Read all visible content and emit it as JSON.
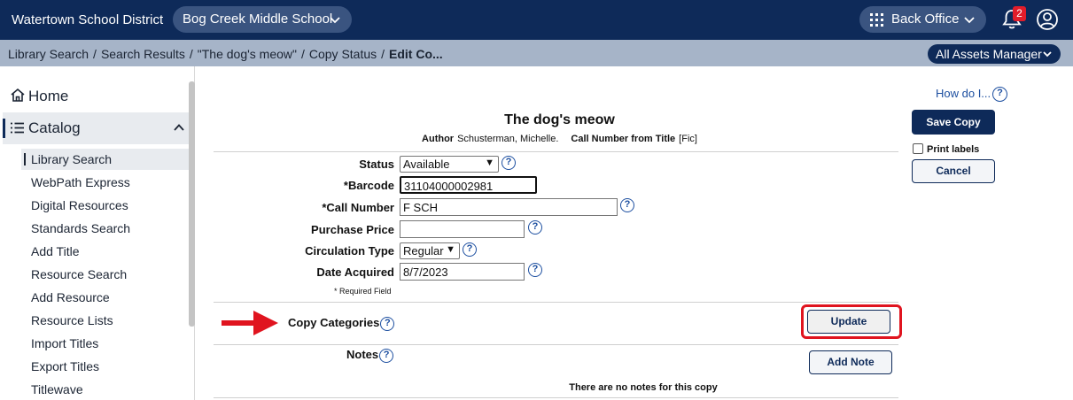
{
  "header": {
    "district": "Watertown School District",
    "school": "Bog Creek Middle School",
    "back_office": "Back Office",
    "notification_count": "2"
  },
  "breadcrumb": {
    "items": [
      "Library Search",
      "Search Results",
      "\"The dog's meow\"",
      "Copy Status"
    ],
    "current": "Edit Co...",
    "separator": "/"
  },
  "assets_manager": "All Assets Manager",
  "sidebar": {
    "home": "Home",
    "catalog": "Catalog",
    "items": [
      "Library Search",
      "WebPath Express",
      "Digital Resources",
      "Standards Search",
      "Add Title",
      "Resource Search",
      "Add Resource",
      "Resource Lists",
      "Import Titles",
      "Export Titles",
      "Titlewave"
    ]
  },
  "right_panel": {
    "how_do_i": "How do I...",
    "save_copy": "Save Copy",
    "print_labels": "Print labels",
    "cancel": "Cancel"
  },
  "record": {
    "title": "The dog's meow",
    "author_label": "Author",
    "author": "Schusterman, Michelle.",
    "call_number_label": "Call Number from Title",
    "call_number": "[Fic]"
  },
  "form": {
    "status_label": "Status",
    "status_value": "Available",
    "barcode_label": "*Barcode",
    "barcode_value": "31104000002981",
    "call_number_label": "*Call Number",
    "call_number_value": "F SCH",
    "purchase_price_label": "Purchase Price",
    "purchase_price_value": "",
    "circulation_type_label": "Circulation Type",
    "circulation_type_value": "Regular",
    "date_acquired_label": "Date Acquired",
    "date_acquired_value": "8/7/2023",
    "required_note": "* Required Field"
  },
  "sections": {
    "copy_categories": "Copy Categories",
    "update": "Update",
    "notes": "Notes",
    "add_note": "Add Note",
    "no_notes": "There are no notes for this copy"
  },
  "colors": {
    "header_bg": "#0e2a59",
    "breadcrumb_bg": "#a6b4c8",
    "highlight": "#e0141f"
  }
}
